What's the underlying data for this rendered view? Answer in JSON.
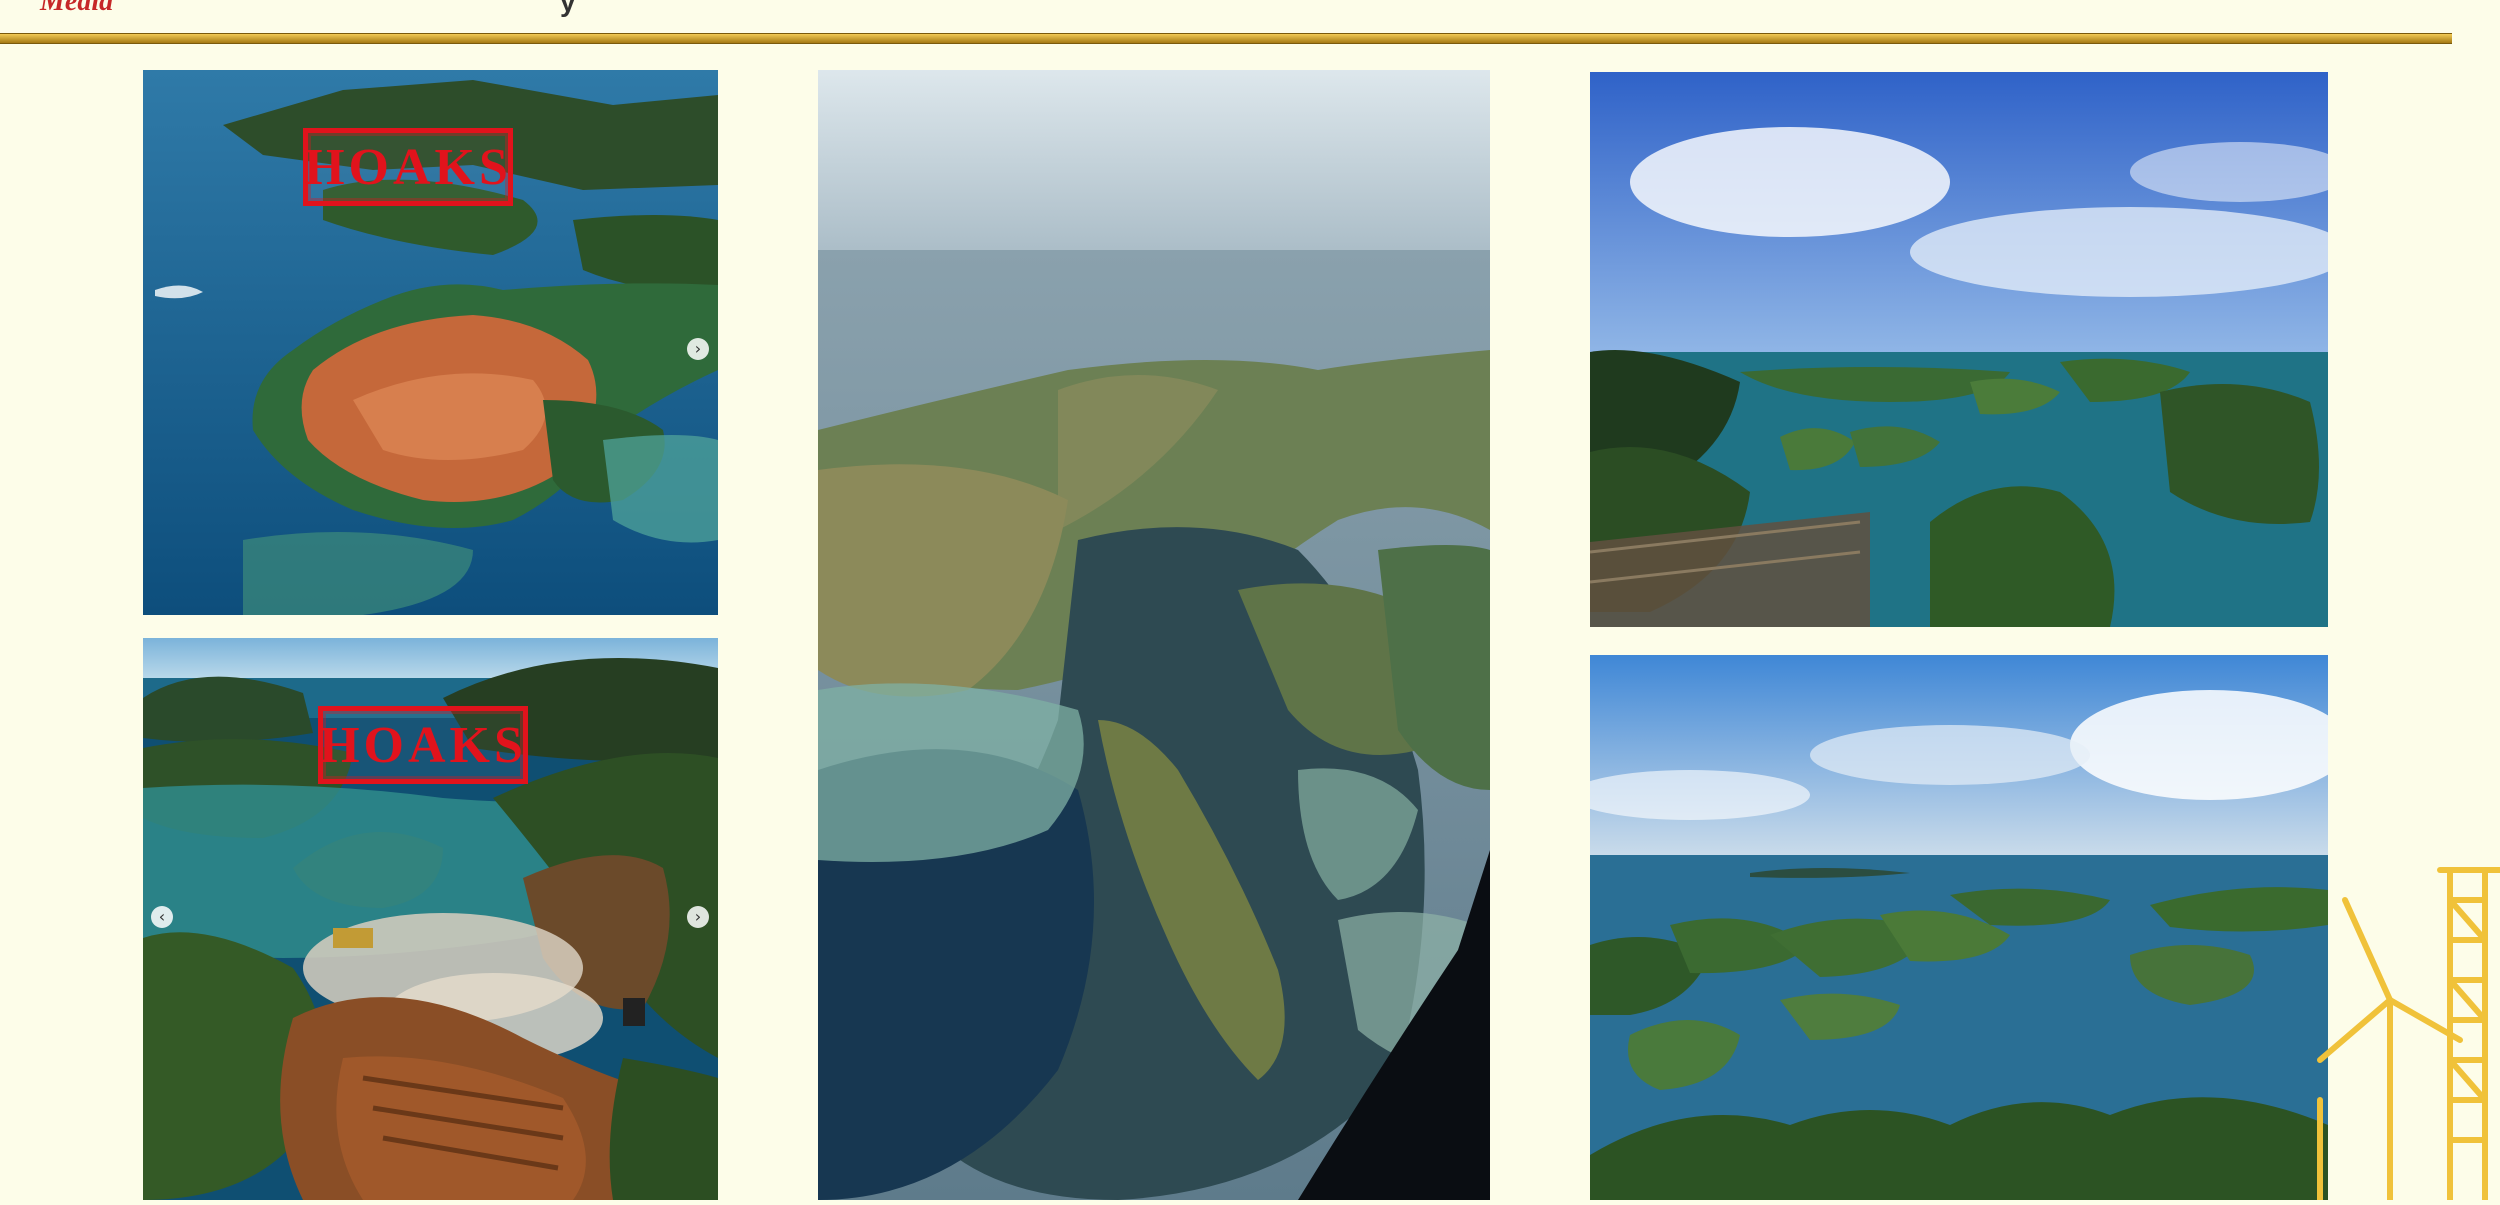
{
  "page": {
    "header_fragment_left": "Media",
    "header_fragment_right": "y"
  },
  "photos": {
    "top_left": {
      "stamp": "HOAKS",
      "description": "aerial island cleared for mining"
    },
    "bottom_left": {
      "stamp": "HOAKS",
      "description": "excavator clearing hillside"
    },
    "center": {},
    "top_right": {},
    "bottom_right": {}
  },
  "icons": {
    "carousel_next": "chevron-right-icon",
    "carousel_prev": "chevron-left-icon",
    "decor": "wind-turbine-icon"
  },
  "colors": {
    "background": "#fdfde9",
    "divider_gold": "#d9a72e",
    "stamp_red": "#e1131c"
  }
}
